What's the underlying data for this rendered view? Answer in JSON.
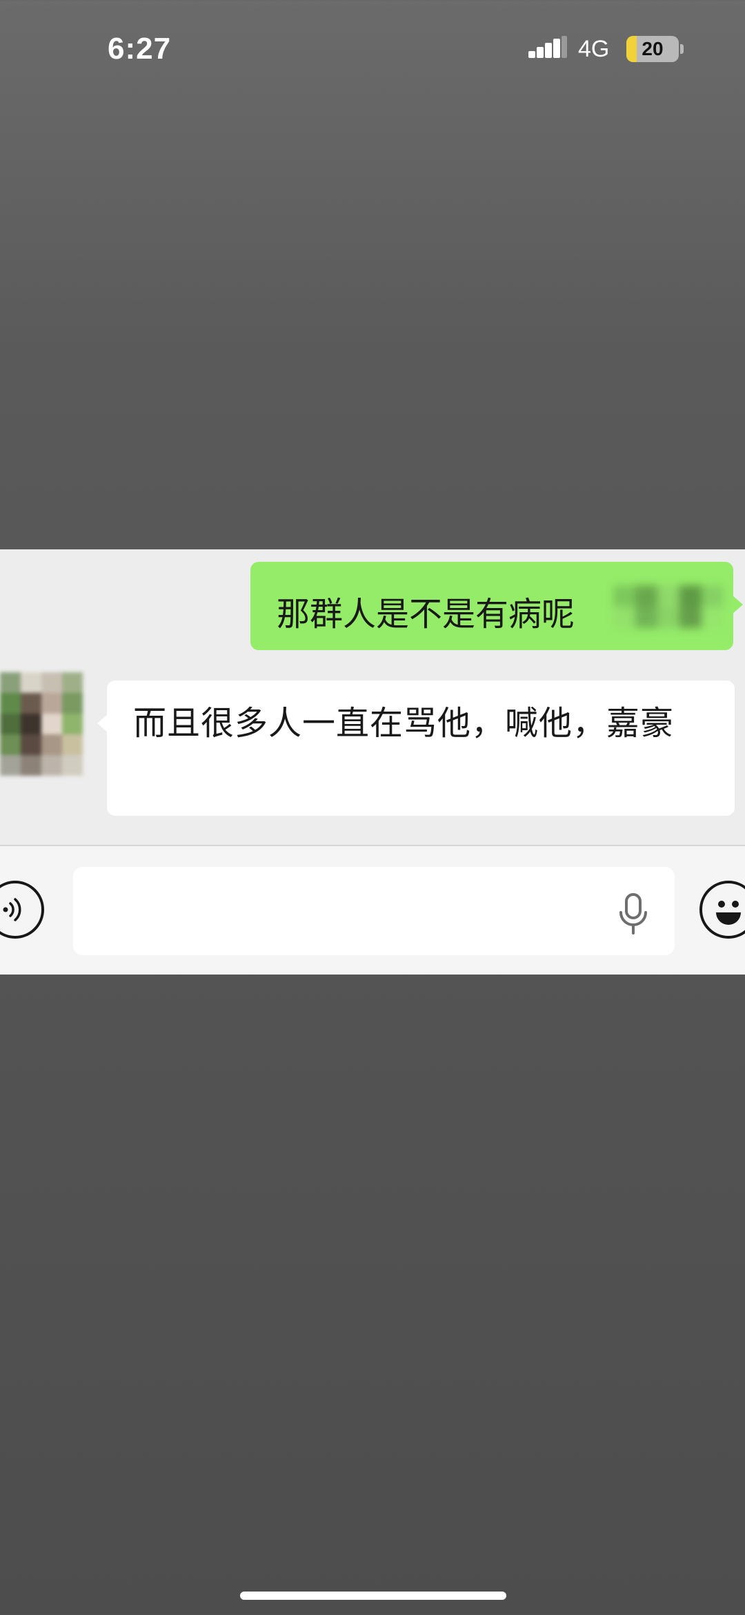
{
  "status_bar": {
    "time": "6:27",
    "network": "4G",
    "battery_level": "20",
    "battery_fill_fraction": 0.2,
    "icons": [
      "signal-icon",
      "battery-icon"
    ]
  },
  "chat": {
    "messages": [
      {
        "direction": "sent",
        "text": "那群人是不是有病呢",
        "partially_obscured": true
      },
      {
        "direction": "received",
        "text": "而且很多人一直在骂他，喊他，嘉豪",
        "avatar": "pixelated-avatar"
      }
    ]
  },
  "input_bar": {
    "input_value": "",
    "icons": [
      "voice-mode-icon",
      "microphone-icon",
      "emoji-icon"
    ]
  },
  "colors": {
    "sent_bubble": "#95ec69",
    "received_bubble": "#ffffff",
    "chat_background": "#ededed",
    "input_bar_background": "#f5f5f5",
    "battery_fill": "#f2d23a",
    "page_background": "#5a5a5a"
  }
}
